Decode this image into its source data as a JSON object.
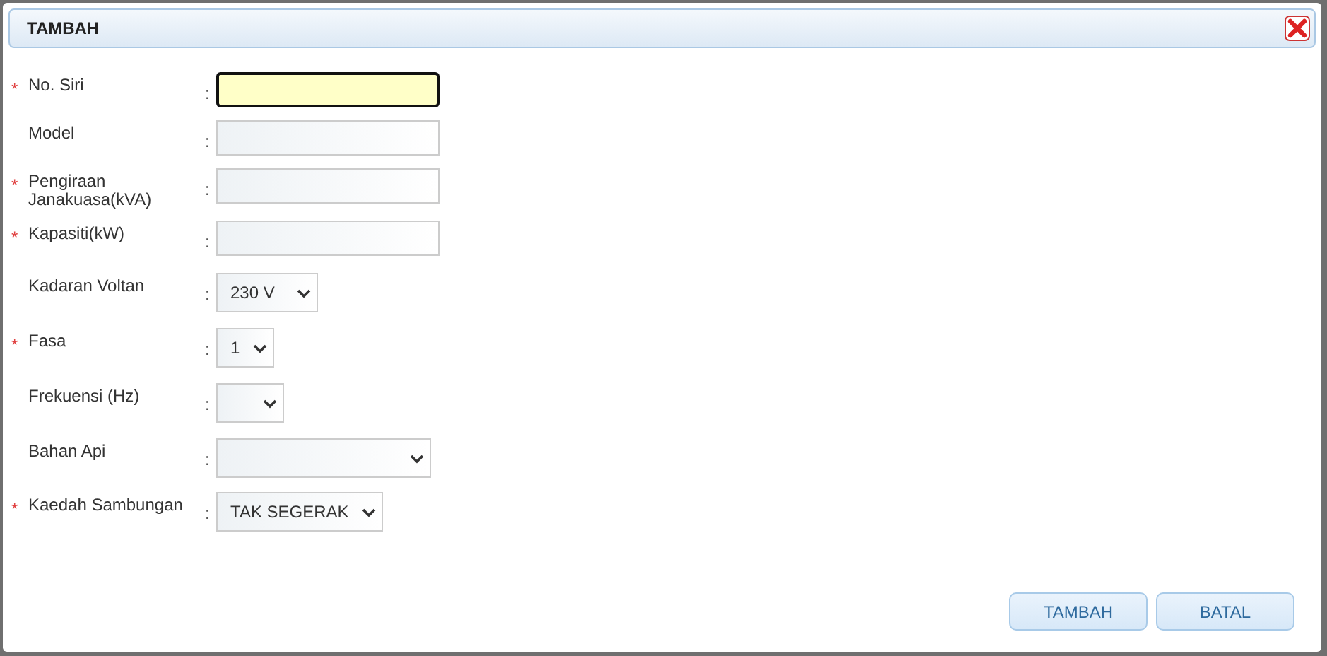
{
  "dialog": {
    "title": "TAMBAH"
  },
  "fields": [
    {
      "required_mark": "*",
      "label": "No. Siri",
      "separator": ":",
      "kind": "text",
      "focused": true
    },
    {
      "label": "Model",
      "separator": ":",
      "kind": "text",
      "focused": false
    },
    {
      "required_mark": "*",
      "label": "Pengiraan Janakuasa(kVA)",
      "separator": ":",
      "kind": "text",
      "focused": false
    },
    {
      "required_mark": "*",
      "label": "Kapasiti(kW)",
      "separator": ":",
      "kind": "text",
      "focused": false
    },
    {
      "label": "Kadaran Voltan",
      "separator": ":",
      "kind": "select",
      "value": "230 V"
    },
    {
      "required_mark": "*",
      "label": "Fasa",
      "separator": ":",
      "kind": "select",
      "value": "1"
    },
    {
      "label": "Frekuensi (Hz)",
      "separator": ":",
      "kind": "select"
    },
    {
      "label": "Bahan Api",
      "separator": ":",
      "kind": "select"
    },
    {
      "required_mark": "*",
      "label": "Kaedah Sambungan",
      "separator": ":",
      "kind": "select",
      "value": "TAK SEGERAK"
    }
  ],
  "buttons": [
    "TAMBAH",
    "BATAL"
  ]
}
